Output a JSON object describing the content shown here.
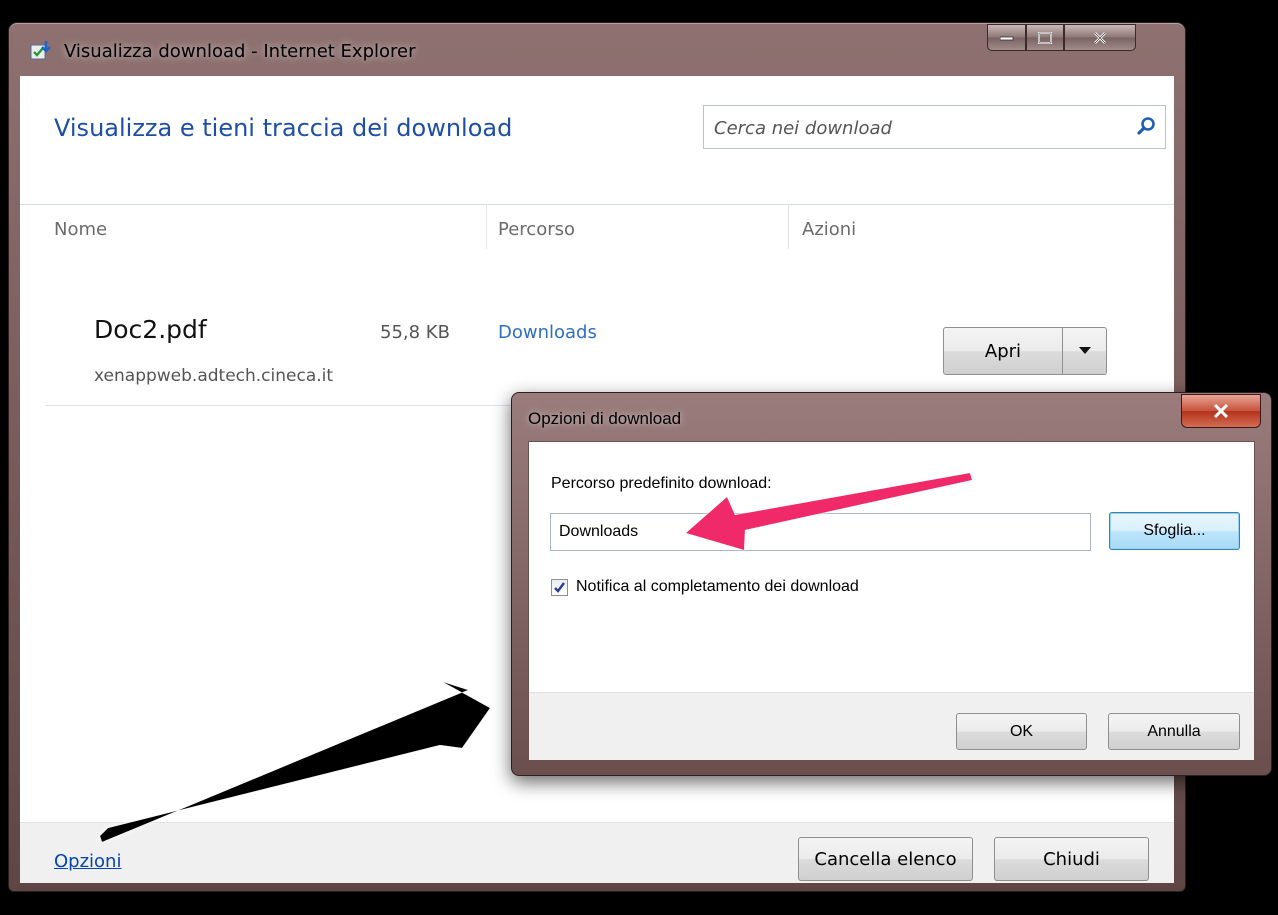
{
  "window": {
    "title": "Visualizza download - Internet Explorer",
    "header": "Visualizza e tieni traccia dei download",
    "search_placeholder": "Cerca nei download"
  },
  "columns": [
    "Nome",
    "Percorso",
    "Azioni"
  ],
  "downloads": [
    {
      "name": "Doc2.pdf",
      "size": "55,8 KB",
      "source": "xenappweb.adtech.cineca.it",
      "location": "Downloads",
      "action": "Apri"
    }
  ],
  "footer": {
    "options_link": "Opzioni",
    "clear_list": "Cancella elenco",
    "close": "Chiudi"
  },
  "dialog": {
    "title": "Opzioni di download",
    "path_label": "Percorso predefinito download:",
    "path_value": "Downloads",
    "browse": "Sfoglia...",
    "notify_label": "Notifica al completamento dei download",
    "notify_checked": true,
    "ok": "OK",
    "cancel": "Annulla"
  },
  "colors": {
    "header_blue": "#1e4fa5",
    "link_blue": "#2f6fc1",
    "annotation_pink": "#f0296b",
    "annotation_black": "#000000"
  }
}
